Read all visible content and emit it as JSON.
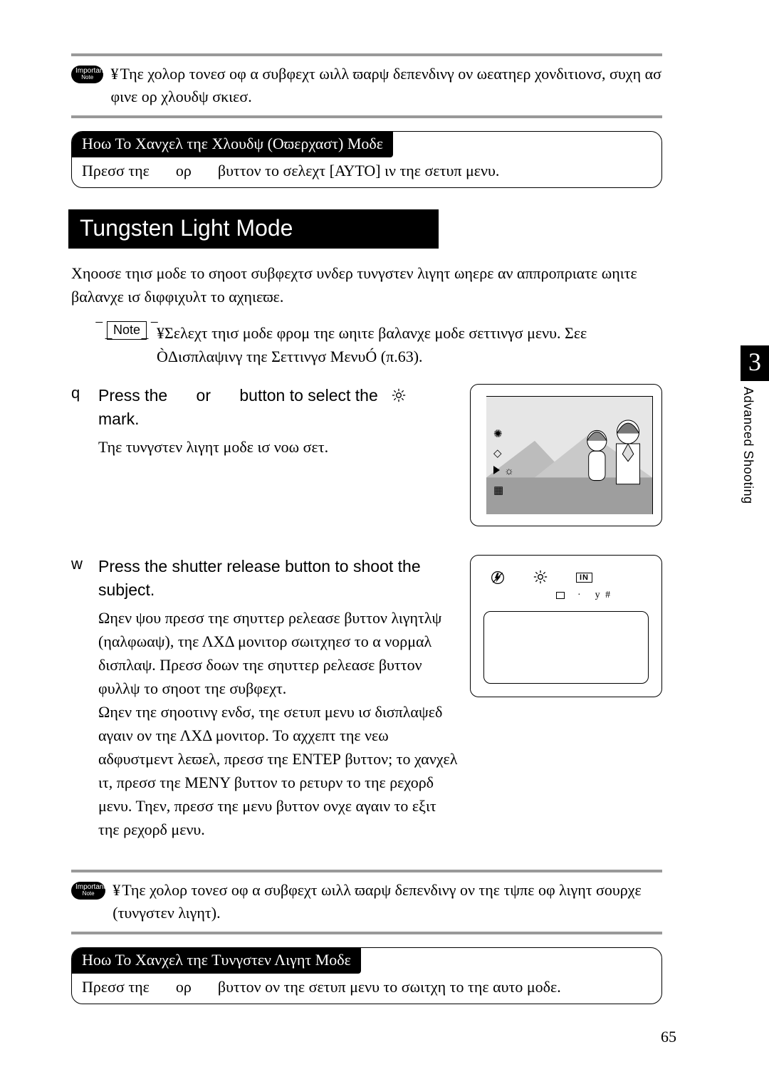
{
  "side": {
    "chapter_num": "3",
    "chapter_label": "Advanced Shooting"
  },
  "page_number": "65",
  "callout_top": {
    "badge_main": "Important",
    "badge_sub": "Note",
    "bullet": "¥",
    "text": "Τηε χολορ τονεσ οφ α συβφεχτ ωιλλ ϖαρψ δεπενδινγ ον ωεατηερ χονδιτιονσ, συχη ασ φινε ορ χλουδψ σκιεσ."
  },
  "cancel_cloudy": {
    "title": "Ηοω Το Χανχελ τηε Χλουδψ (Οϖερχαστ) Μοδε",
    "body_prefix": "Πρεσσ τηε",
    "body_mid": "ορ",
    "body_suffix": "βυττον το σελεχτ [ΑΥΤΟ] ιν τηε σετυπ μενυ."
  },
  "section_title": "Tungsten Light Mode",
  "intro": "Χηοοσε τηισ μοδε το σηοοτ συβφεχτσ υνδερ τυνγστεν λιγητ ωηερε αν αππροπριατε ωηιτε βαλανχε ισ διφφιχυλτ το αχηιεϖε.",
  "note": {
    "label": "Note",
    "bullet": "¥",
    "text": "Σελεχτ τηισ μοδε φρομ τηε ωηιτε βαλανχε μοδε σεττινγσ μενυ.  Σεε ÒΔισπλαψινγ τηε Σεττινγσ ΜενυÓ (π.63)."
  },
  "step1": {
    "marker": "q",
    "head_prefix": "Press the",
    "head_mid": "or",
    "head_suffix": "button to select the",
    "head_tail": "mark.",
    "sub": "Τηε τυνγστεν λιγητ μοδε ισ νοω σετ."
  },
  "step2": {
    "marker": "w",
    "head": "Press the shutter release button to shoot the subject.",
    "sub": "Ωηεν ψου πρεσσ τηε σηυττερ ρελεασε βυττον λιγητλψ (ηαλφωαψ), τηε ΛΧΔ μονιτορ σωιτχηεσ το α νορμαλ δισπλαψ.  Πρεσσ δοων τηε σηυττερ ρελεασε βυττον φυλλψ το σηοοτ τηε συβφεχτ.\nΩηεν τηε σηοοτινγ ενδσ, τηε σετυπ μενυ ισ δισπλαψεδ αγαιν ον τηε ΛΧΔ μονιτορ.  Το αχχεπτ τηε νεω αδφυστμεντ λεϖελ, πρεσσ τηε ΕΝΤΕΡ βυττον; το χανχελ ιτ, πρεσσ τηε ΜΕΝΥ βυττον το ρετυρν το τηε ρεχορδ μενυ.  Τηεν, πρεσσ τηε μενυ βυττον ονχε αγαιν το εξιτ τηε ρεχορδ μενυ.",
    "lcd_sub_text": "y #"
  },
  "callout_bottom": {
    "badge_main": "Important",
    "badge_sub": "Note",
    "bullet": "¥",
    "text": "Τηε χολορ τονεσ οφ α συβφεχτ ωιλλ ϖαρψ δεπενδινγ ον τηε τψπε οφ λιγητ σουρχε (τυνγστεν λιγητ)."
  },
  "cancel_tungsten": {
    "title": "Ηοω Το Χανχελ τηε Τυνγστεν Λιγητ Μοδε",
    "body_prefix": "Πρεσσ τηε",
    "body_mid": "ορ",
    "body_suffix": "βυττον ον τηε σετυπ μενυ το σωιτχη το τηε αυτο μοδε."
  },
  "icons": {
    "sun_name": "sun-icon",
    "flash_off_name": "flash-off-icon",
    "in_badge": "IN"
  }
}
